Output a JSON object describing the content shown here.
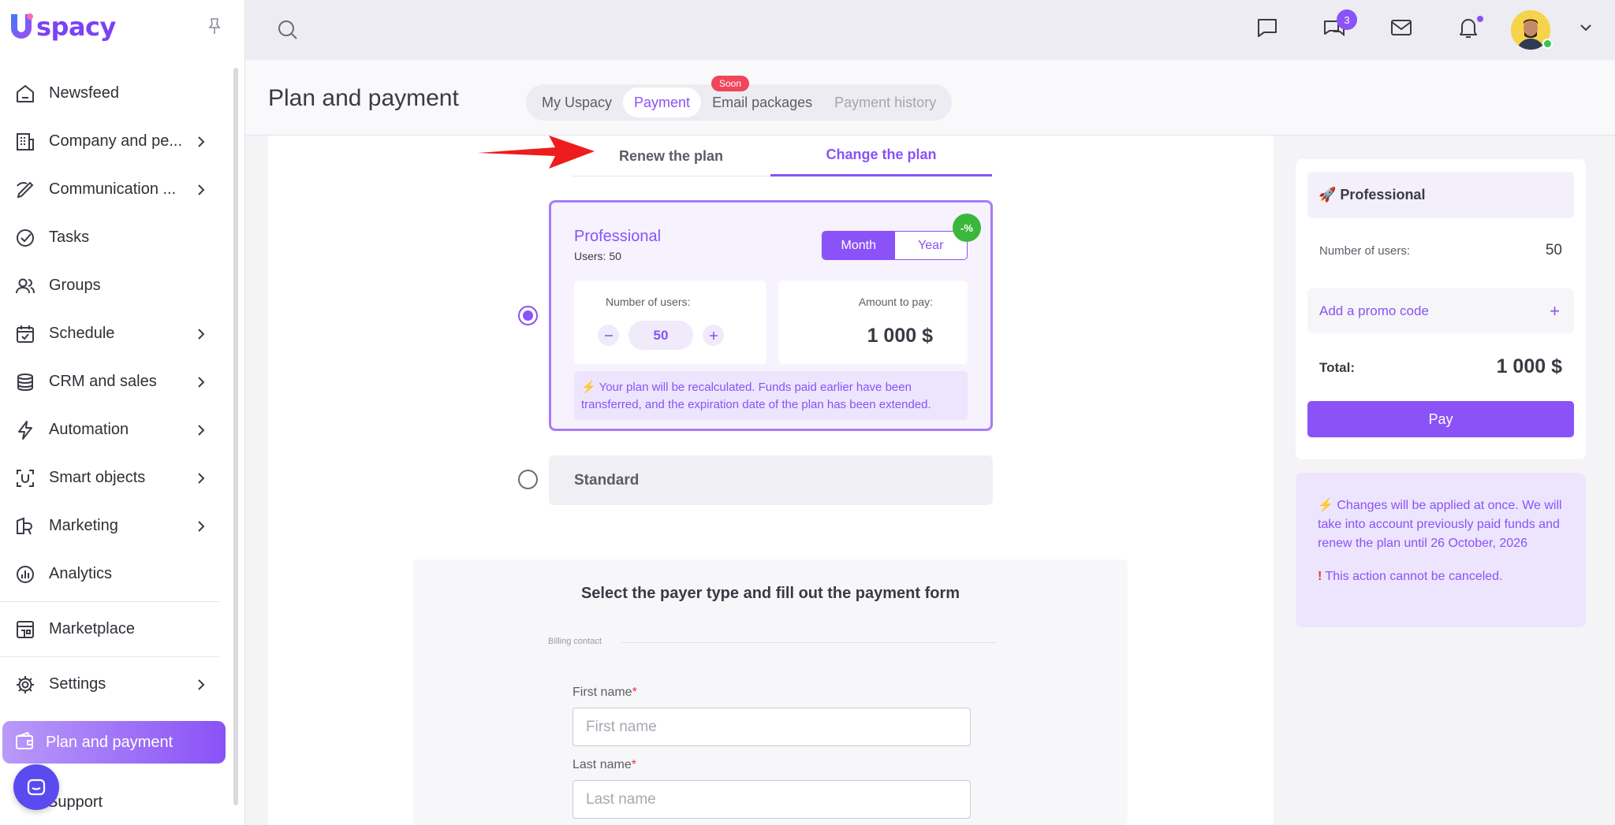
{
  "app": {
    "logo_text": "spacy"
  },
  "sidebar": {
    "items": [
      {
        "label": "Newsfeed",
        "icon": "home-icon",
        "chevron": false
      },
      {
        "label": "Company and pe...",
        "icon": "building-icon",
        "chevron": true
      },
      {
        "label": "Communication ...",
        "icon": "communication-icon",
        "chevron": true
      },
      {
        "label": "Tasks",
        "icon": "check-circle-icon",
        "chevron": false
      },
      {
        "label": "Groups",
        "icon": "users-icon",
        "chevron": false
      },
      {
        "label": "Schedule",
        "icon": "calendar-icon",
        "chevron": true
      },
      {
        "label": "CRM and sales",
        "icon": "database-icon",
        "chevron": true
      },
      {
        "label": "Automation",
        "icon": "lightning-icon",
        "chevron": true
      },
      {
        "label": "Smart objects",
        "icon": "scan-icon",
        "chevron": true
      },
      {
        "label": "Marketing",
        "icon": "megaphone-icon",
        "chevron": true
      },
      {
        "label": "Analytics",
        "icon": "chart-icon",
        "chevron": false
      }
    ],
    "marketplace": "Marketplace",
    "settings": "Settings",
    "active": "Plan and payment",
    "support": "Support"
  },
  "topbar": {
    "chat_badge": "3"
  },
  "header": {
    "title": "Plan and payment",
    "tabs": [
      {
        "label": "My Uspacy",
        "state": "normal"
      },
      {
        "label": "Payment",
        "state": "active"
      },
      {
        "label": "Email packages",
        "state": "normal"
      },
      {
        "label": "Payment history",
        "state": "disabled"
      }
    ],
    "soon_badge": "Soon"
  },
  "subtabs": {
    "renew": "Renew the plan",
    "change": "Change the plan"
  },
  "plan": {
    "name": "Professional",
    "users": "Users: 50",
    "period_month": "Month",
    "period_year": "Year",
    "discount": "-%",
    "users_label": "Number of users:",
    "users_value": "50",
    "amount_label": "Amount to pay:",
    "amount_value": "1 000 $",
    "note": "⚡ Your plan will be recalculated. Funds paid earlier have been transferred, and the expiration date of the plan has been extended."
  },
  "standard": {
    "name": "Standard"
  },
  "form": {
    "title": "Select the payer type and fill out the payment form",
    "section": "Billing contact",
    "first_name_label": "First name",
    "first_name_placeholder": "First name",
    "last_name_label": "Last name",
    "last_name_placeholder": "Last name",
    "required_mark": "*"
  },
  "summary": {
    "plan": "🚀 Professional",
    "users_label": "Number of users:",
    "users_value": "50",
    "promo": "Add a promo code",
    "promo_plus": "+",
    "total_label": "Total:",
    "total_value": "1 000 $",
    "pay": "Pay"
  },
  "notice": {
    "text": "⚡ Changes will be applied at once. We will take into account previously paid funds and renew the plan until 26 October, 2026",
    "warning_mark": "!",
    "warning": " This action cannot be canceled."
  },
  "colors": {
    "accent": "#8a52f7",
    "danger": "#e23a3a",
    "arrow": "#ee1c1c"
  }
}
